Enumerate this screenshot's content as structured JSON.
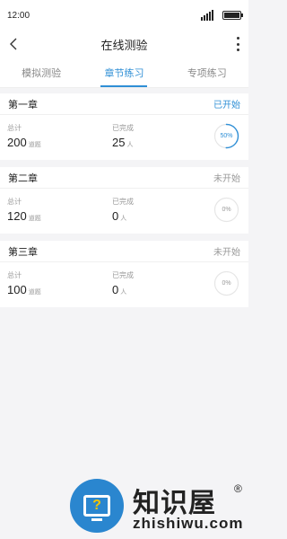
{
  "status_bar": {
    "time": "12:00"
  },
  "nav": {
    "title": "在线测验"
  },
  "tabs": [
    {
      "label": "模拟测验",
      "active": false
    },
    {
      "label": "章节练习",
      "active": true
    },
    {
      "label": "专项练习",
      "active": false
    }
  ],
  "chapters": [
    {
      "title": "第一章",
      "status": "已开始",
      "total_label": "总计",
      "total": "200",
      "total_unit": "道题",
      "done_label": "已完成",
      "done": "25",
      "done_unit": "人",
      "progress": 0.5,
      "progress_text": "50%"
    },
    {
      "title": "第二章",
      "status": "未开始",
      "total_label": "总计",
      "total": "120",
      "total_unit": "道题",
      "done_label": "已完成",
      "done": "0",
      "done_unit": "人",
      "progress": 0,
      "progress_text": "0%"
    },
    {
      "title": "第三章",
      "status": "未开始",
      "total_label": "总计",
      "total": "100",
      "total_unit": "道题",
      "done_label": "已完成",
      "done": "0",
      "done_unit": "人",
      "progress": 0,
      "progress_text": "0%"
    }
  ],
  "watermark": {
    "cn": "知识屋",
    "reg": "®",
    "en": "zhishiwu.com",
    "mark": "?"
  },
  "colors": {
    "accent": "#2f8fd6",
    "muted": "#999999",
    "background": "#f4f4f6"
  },
  "icons": {
    "back": "chevron-left-icon",
    "more": "more-vertical-icon",
    "signal": "signal-icon",
    "battery": "battery-icon"
  }
}
